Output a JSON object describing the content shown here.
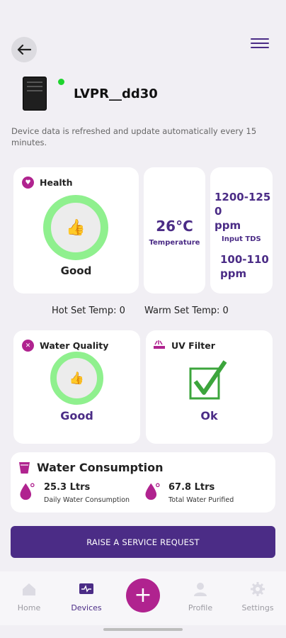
{
  "device": {
    "name": "LVPR__dd30"
  },
  "info_text": "Device data is refreshed and update automatically every 15 minutes.",
  "health": {
    "title": "Health",
    "status": "Good"
  },
  "temperature": {
    "value": "26°C",
    "label": "Temperature"
  },
  "tds": {
    "input_line1": "1200-125",
    "input_line2": "0",
    "input_unit": "ppm",
    "input_label": "Input TDS",
    "output_line1": "100-110",
    "output_unit": "ppm"
  },
  "set_temps": {
    "hot": "Hot Set Temp: 0",
    "warm": "Warm Set Temp: 0"
  },
  "water_quality": {
    "title": "Water Quality",
    "status": "Good"
  },
  "uv_filter": {
    "title": "UV Filter",
    "status": "Ok"
  },
  "consumption": {
    "title": "Water Consumption",
    "daily_value": "25.3 Ltrs",
    "daily_label": "Daily Water Consumption",
    "total_value": "67.8 Ltrs",
    "total_label": "Total Water Purified"
  },
  "service_button": "RAISE A SERVICE REQUEST",
  "nav": {
    "home": "Home",
    "devices": "Devices",
    "add": "+",
    "profile": "Profile",
    "settings": "Settings"
  },
  "colors": {
    "primary": "#4b2c86",
    "accent": "#b0238f",
    "ring": "#8ff08e",
    "check": "#3ca53c",
    "online": "#1fd42e"
  }
}
